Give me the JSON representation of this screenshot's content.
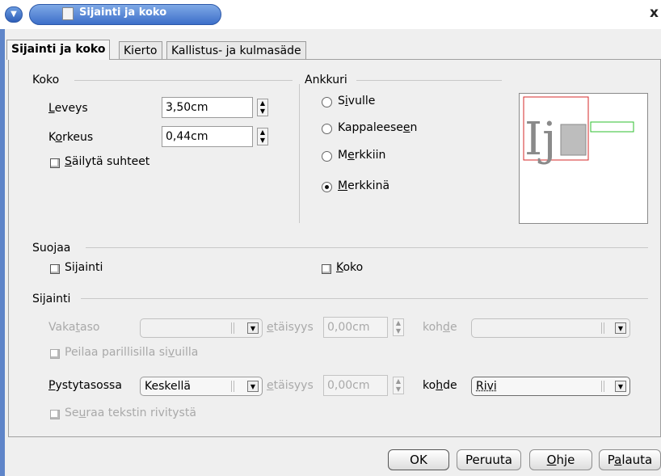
{
  "window": {
    "title": "Sijainti ja koko",
    "close": "x"
  },
  "tabs": [
    {
      "label": "Sijainti ja koko",
      "active": true
    },
    {
      "label": "Kierto",
      "active": false
    },
    {
      "label": "Kallistus- ja kulmasäde",
      "active": false
    }
  ],
  "size": {
    "group": "Koko",
    "width_label": "Leveys",
    "width_value": "3,50cm",
    "height_label": "Korkeus",
    "height_value": "0,44cm",
    "keep_ratio": "Säilytä suhteet"
  },
  "anchor": {
    "group": "Ankkuri",
    "options": [
      {
        "label": "Sivulle",
        "selected": false
      },
      {
        "label": "Kappaleeseen",
        "selected": false
      },
      {
        "label": "Merkkiin",
        "selected": false
      },
      {
        "label": "Merkkinä",
        "selected": true
      }
    ],
    "preview_glyph": "Ij"
  },
  "protect": {
    "group": "Suojaa",
    "position": "Sijainti",
    "size": "Koko"
  },
  "position": {
    "group": "Sijainti",
    "horizontal_label": "Vaakataso",
    "horizontal_value": "",
    "distance_label": "etäisyys",
    "horizontal_distance": "0,00cm",
    "target_label": "kohde",
    "horizontal_target": "",
    "mirror": "Peilaa parillisilla sivuilla",
    "vertical_label": "Pystytasossa",
    "vertical_value": "Keskellä",
    "vertical_distance": "0,00cm",
    "vertical_target": "Rivi",
    "follow": "Seuraa tekstin rivitystä"
  },
  "buttons": {
    "ok": "OK",
    "cancel": "Peruuta",
    "help": "Ohje",
    "reset": "Palauta"
  },
  "colors": {
    "title_bar": "#3d6fc9",
    "preview_frame": "#d62828",
    "preview_box": "#2fbf2f"
  }
}
